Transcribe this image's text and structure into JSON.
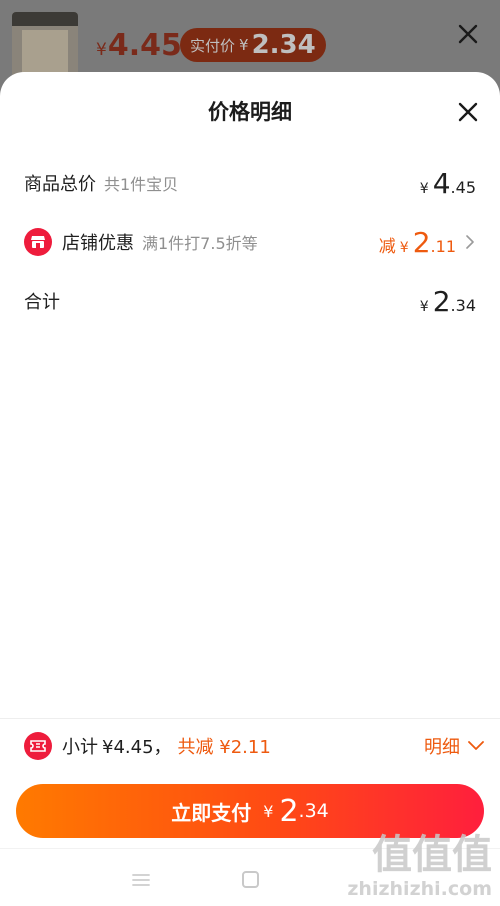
{
  "top_bar": {
    "price_symbol": "¥",
    "price": "4.45",
    "actual_label": "实付价",
    "actual_symbol": "¥",
    "actual_price": "2.34"
  },
  "sheet": {
    "title": "价格明细",
    "rows": {
      "total": {
        "label": "商品总价",
        "sub": "共1件宝贝",
        "symbol": "¥",
        "int": "4",
        "dec": ".45"
      },
      "shop_discount": {
        "label": "店铺优惠",
        "sub": "满1件打7.5折等",
        "prefix": "减",
        "symbol": "¥",
        "int": "2",
        "dec": ".11"
      },
      "sum": {
        "label": "合计",
        "symbol": "¥",
        "int": "2",
        "dec": ".34"
      }
    }
  },
  "summary": {
    "subtotal_label": "小计",
    "subtotal_value": "¥4.45，",
    "saved_text": "共减 ¥2.11",
    "detail_label": "明细"
  },
  "pay_button": {
    "label": "立即支付",
    "symbol": "¥",
    "int": "2",
    "dec": ".34"
  },
  "watermark": {
    "logo": "值值值",
    "url": "zhizhizhi.com"
  },
  "colors": {
    "accent": "#ee5a0f",
    "brand_red": "#ee1c3c",
    "button_start": "#ff7a00",
    "button_end": "#ff1f3d"
  }
}
